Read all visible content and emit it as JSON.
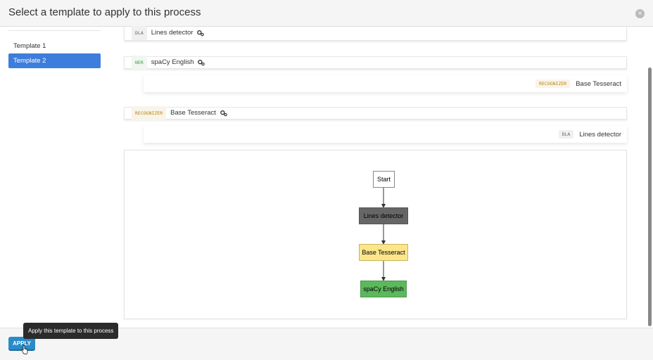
{
  "modal": {
    "title": "Select a template to apply to this process",
    "close_label": "×"
  },
  "sidebar": {
    "items": [
      {
        "label": "Template 1",
        "active": false
      },
      {
        "label": "Template 2",
        "active": true
      }
    ]
  },
  "tasks": [
    {
      "type": "DLA",
      "label": "Lines detector",
      "icon": "gears-icon",
      "children": []
    },
    {
      "type": "NER",
      "label": "spaCy English",
      "icon": "gears-icon",
      "children": [
        {
          "type": "RECOGNIZER",
          "label": "Base Tesseract"
        }
      ]
    },
    {
      "type": "RECOGNIZER",
      "label": "Base Tesseract",
      "icon": "gears-icon",
      "children": [
        {
          "type": "DLA",
          "label": "Lines detector"
        }
      ]
    }
  ],
  "graph": {
    "nodes": [
      {
        "label": "Start",
        "fill": "#ffffff",
        "text_color": "#000000"
      },
      {
        "label": "Lines detector",
        "fill": "#666666",
        "text_color": "#000000"
      },
      {
        "label": "Base Tesseract",
        "fill": "#fde68a",
        "text_color": "#000000"
      },
      {
        "label": "spaCy English",
        "fill": "#5cb85c",
        "text_color": "#000000"
      }
    ]
  },
  "footer": {
    "apply_label": "APPLY",
    "tooltip": "Apply this template to this process"
  },
  "colors": {
    "accent": "#3d7ddb",
    "apply_button": "#2a8bc8"
  }
}
